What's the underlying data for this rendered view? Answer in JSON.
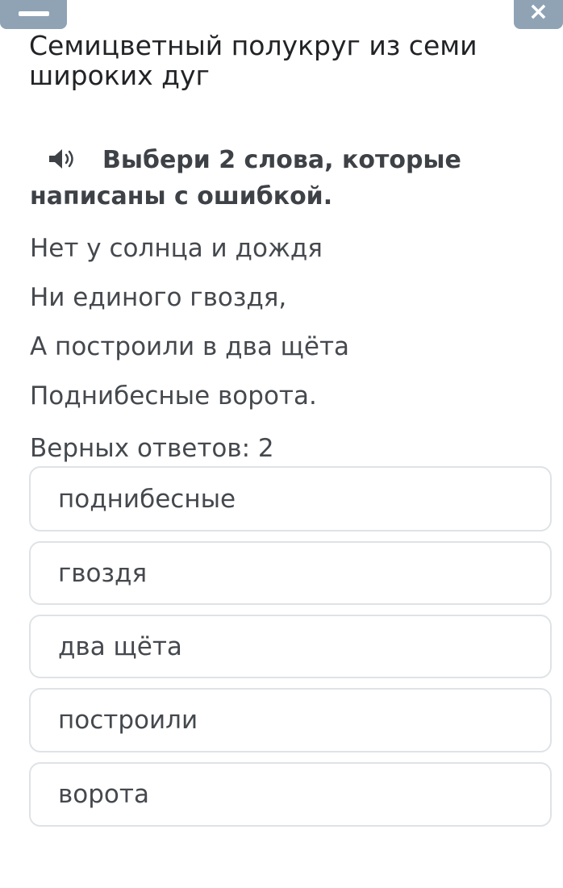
{
  "header": {
    "menu_icon": "hamburger-icon",
    "close_icon": "close-icon",
    "close_glyph": "×"
  },
  "task": {
    "title": "Семицветный полукруг из семи широких дуг",
    "instruction": "Выбери 2 слова, которые написаны с ошибкой.",
    "audio_icon": "speaker-icon",
    "poem": [
      "Нет у солнца и дождя",
      "Ни единого гвоздя,",
      "А построили в два щёта",
      "Поднибесные ворота."
    ],
    "answers_count": "Верных ответов: 2"
  },
  "options": [
    "поднибесные",
    "гвоздя",
    "два щёта",
    "построили",
    "ворота"
  ],
  "colors": {
    "header_button": "#8fa3b5",
    "option_border": "#dfe3e6",
    "text": "#45494e"
  }
}
